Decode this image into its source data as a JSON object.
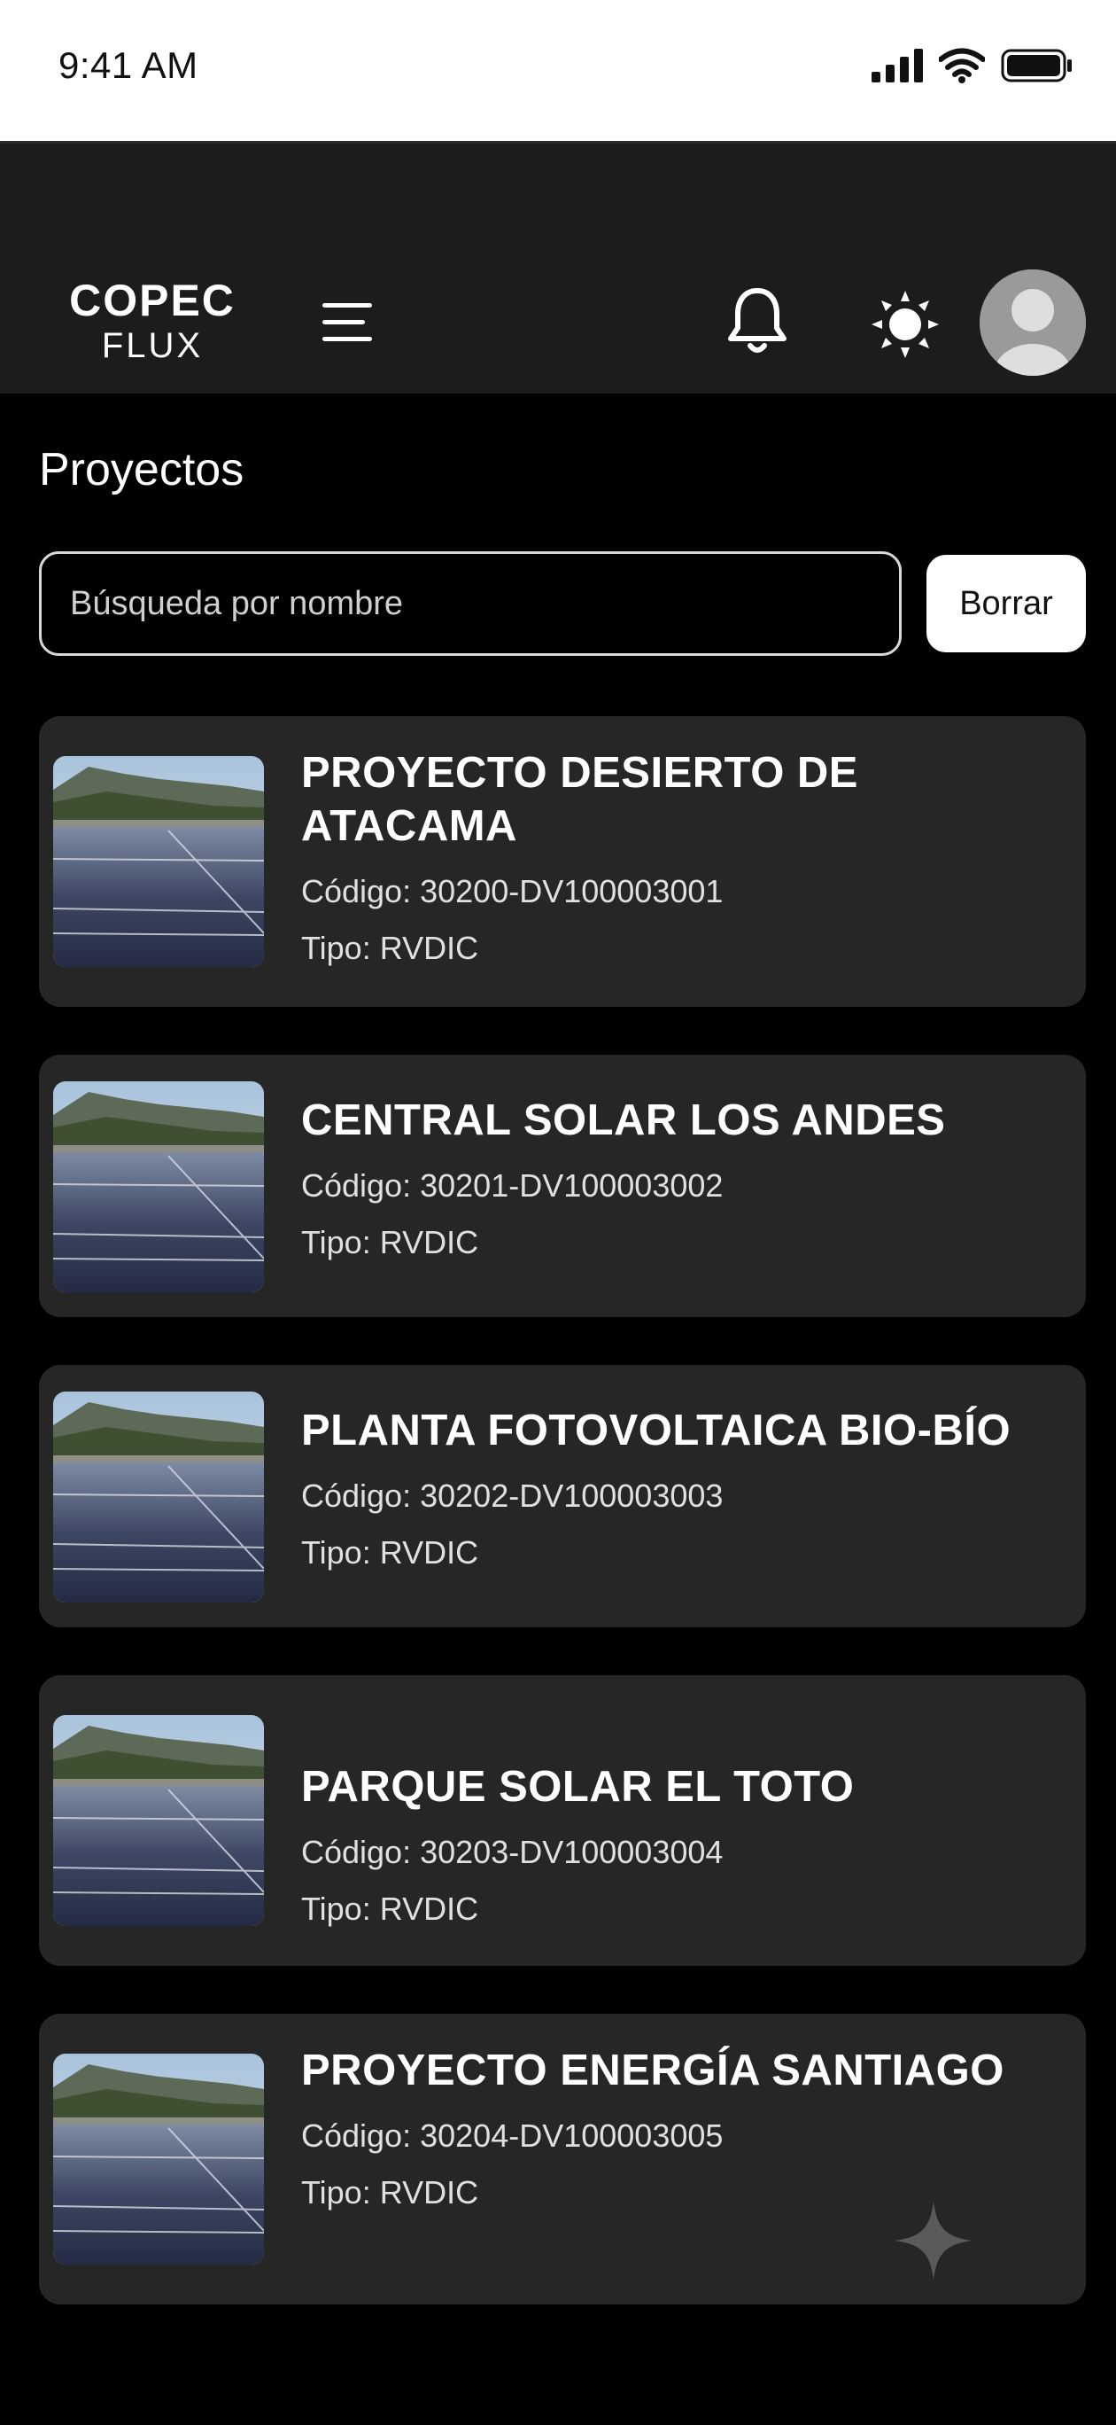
{
  "status_bar": {
    "time": "9:41 AM"
  },
  "header": {
    "logo_top": "COPEC",
    "logo_bottom": "FLUX",
    "icons": [
      "menu-icon",
      "bell-icon",
      "sun-icon",
      "avatar"
    ]
  },
  "main": {
    "title": "Proyectos",
    "search": {
      "placeholder": "Búsqueda por nombre",
      "value": ""
    },
    "clear_label": "Borrar",
    "code_label": "Código:",
    "type_label": "Tipo:",
    "projects": [
      {
        "name": "PROYECTO DESIERTO DE ATACAMA",
        "code": "30200-DV100003001",
        "type": "RVDIC"
      },
      {
        "name": "CENTRAL SOLAR LOS ANDES",
        "code": "30201-DV100003002",
        "type": "RVDIC"
      },
      {
        "name": "PLANTA FOTOVOLTAICA BIO-BÍO",
        "code": "30202-DV100003003",
        "type": "RVDIC"
      },
      {
        "name": "PARQUE SOLAR EL TOTO",
        "code": "30203-DV100003004",
        "type": "RVDIC"
      },
      {
        "name": "PROYECTO ENERGÍA SANTIAGO",
        "code": "30204-DV100003005",
        "type": "RVDIC"
      }
    ]
  },
  "colors": {
    "background": "#000000",
    "header": "#1c1c1c",
    "card": "#262626",
    "text": "#ffffff"
  }
}
